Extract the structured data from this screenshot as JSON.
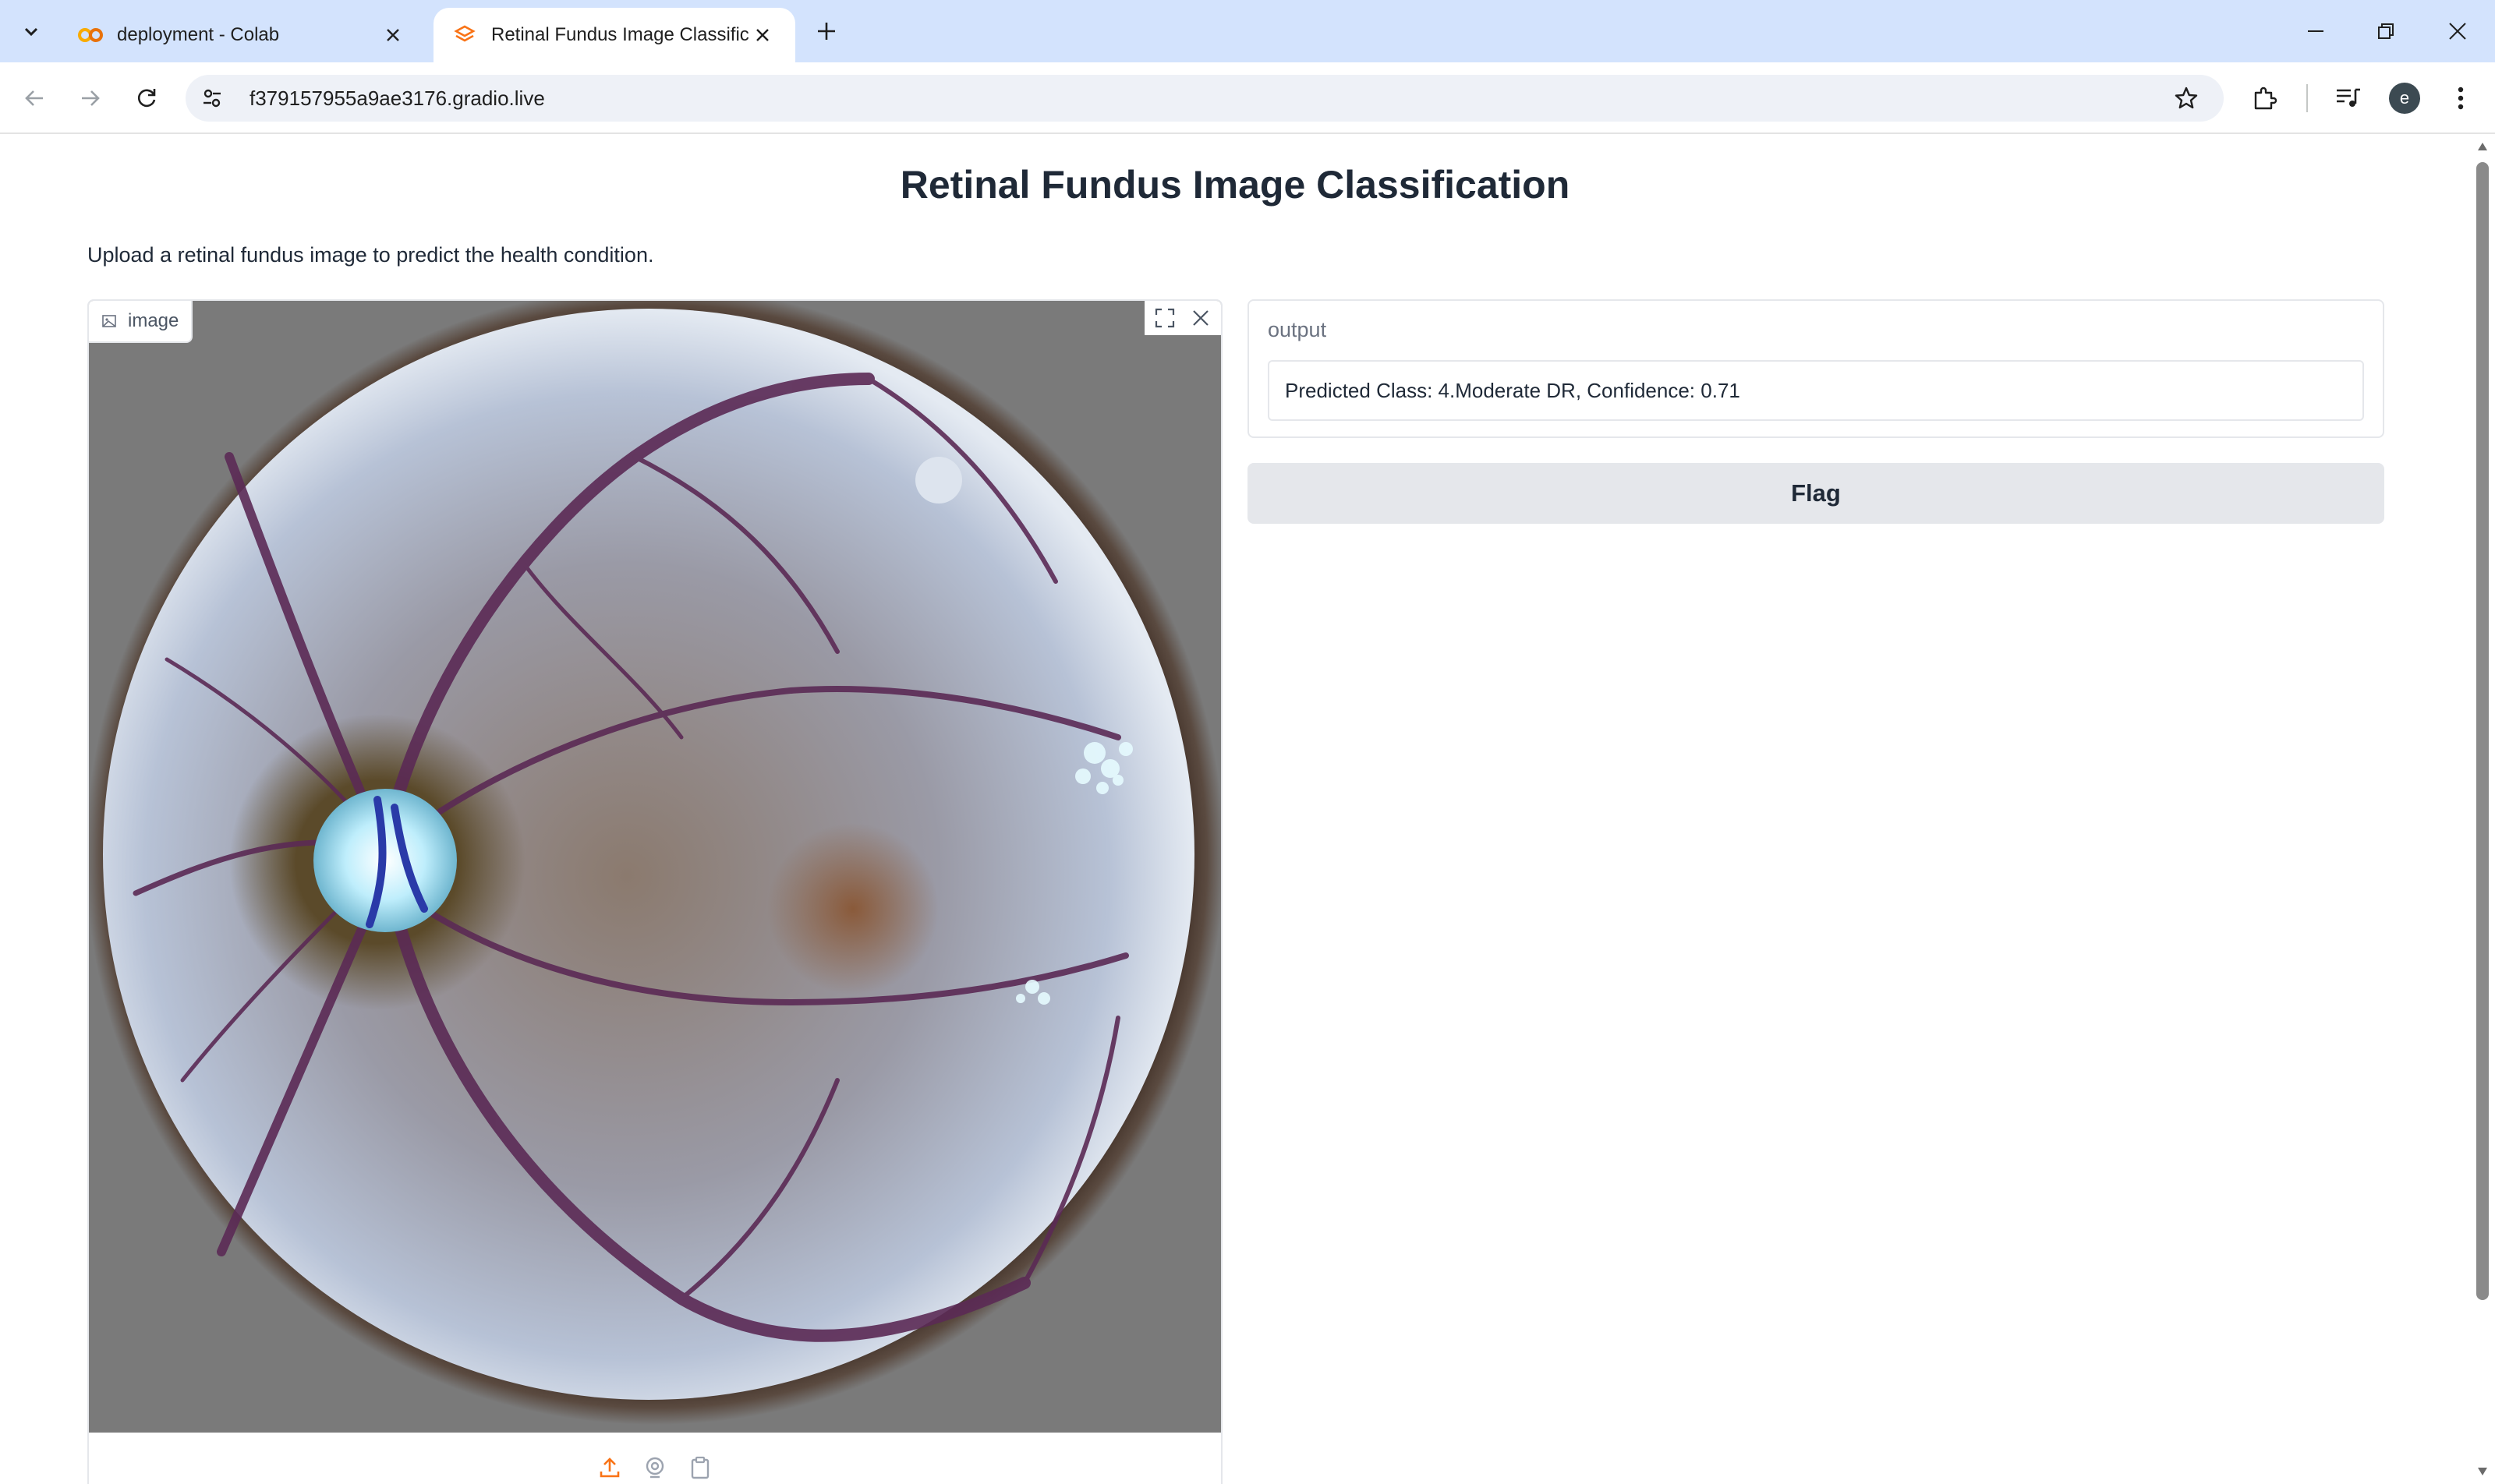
{
  "browser": {
    "tabs": [
      {
        "title": "deployment - Colab",
        "icon": "colab-logo-icon",
        "active": false
      },
      {
        "title": "Retinal Fundus Image Classification",
        "icon": "gradio-logo-icon",
        "active": true
      }
    ],
    "url": "f379157955a9ae3176.gradio.live",
    "profile_initial": "e"
  },
  "app": {
    "title": "Retinal Fundus Image Classification",
    "description": "Upload a retinal fundus image to predict the health condition.",
    "image_input": {
      "label": "image",
      "content": "retinal fundus photograph"
    },
    "output": {
      "label": "output",
      "value": "Predicted Class: 4.Moderate DR, Confidence: 0.71"
    },
    "flag_button": "Flag"
  },
  "colors": {
    "tabstrip_bg": "#d3e3fd",
    "accent_orange": "#f97316",
    "button_gray": "#e5e7eb"
  }
}
